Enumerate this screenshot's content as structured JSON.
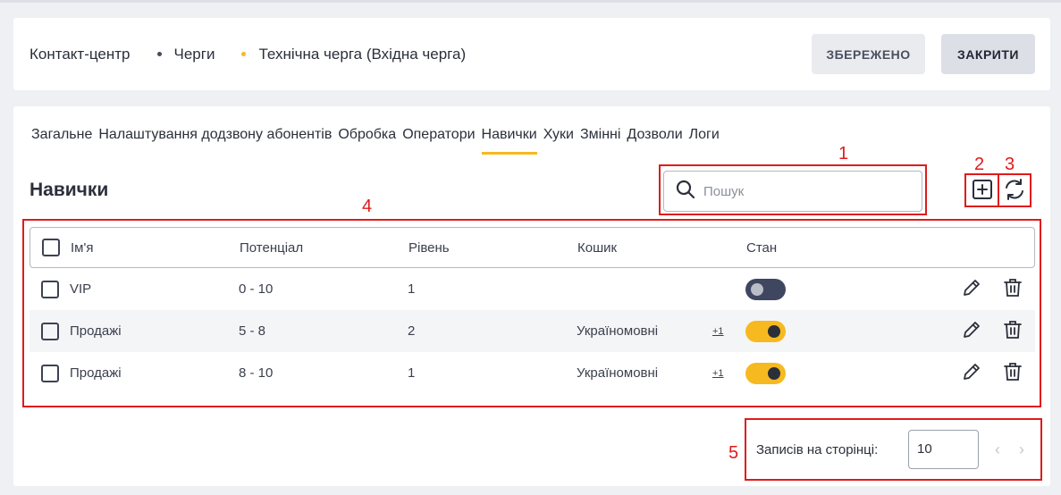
{
  "breadcrumb": {
    "items": [
      "Контакт-центр",
      "Черги",
      "Технічна черга (Вхідна черга)"
    ]
  },
  "header": {
    "saved_label": "ЗБЕРЕЖЕНО",
    "close_label": "ЗАКРИТИ"
  },
  "tabs": [
    {
      "label": "Загальне"
    },
    {
      "label": "Налаштування додзвону абонентів"
    },
    {
      "label": "Обробка"
    },
    {
      "label": "Оператори"
    },
    {
      "label": "Навички",
      "active": true
    },
    {
      "label": "Хуки"
    },
    {
      "label": "Змінні"
    },
    {
      "label": "Дозволи"
    },
    {
      "label": "Логи"
    }
  ],
  "section": {
    "title": "Навички"
  },
  "search": {
    "placeholder": "Пошук",
    "value": ""
  },
  "icons": {
    "add": "add-square-icon",
    "refresh": "refresh-icon",
    "search": "search-icon",
    "edit": "pencil-icon",
    "delete": "trash-icon"
  },
  "table": {
    "headers": [
      "Ім'я",
      "Потенціал",
      "Рівень",
      "Кошик",
      "Стан"
    ],
    "rows": [
      {
        "name": "VIP",
        "potential": "0 - 10",
        "level": "1",
        "bin": "",
        "bin_extra": "",
        "state_on": false
      },
      {
        "name": "Продажі",
        "potential": "5 - 8",
        "level": "2",
        "bin": "Україномовні",
        "bin_extra": "+1",
        "state_on": true
      },
      {
        "name": "Продажі",
        "potential": "8 - 10",
        "level": "1",
        "bin": "Україномовні",
        "bin_extra": "+1",
        "state_on": true
      }
    ]
  },
  "pagination": {
    "label": "Записів на сторінці:",
    "per_page": "10",
    "prev": "‹",
    "next": "›"
  },
  "annotations": [
    "1",
    "2",
    "3",
    "4",
    "5"
  ],
  "colors": {
    "accent": "#f6b91f",
    "toggle_off": "#3f4660",
    "annotation": "#e01b1b"
  }
}
